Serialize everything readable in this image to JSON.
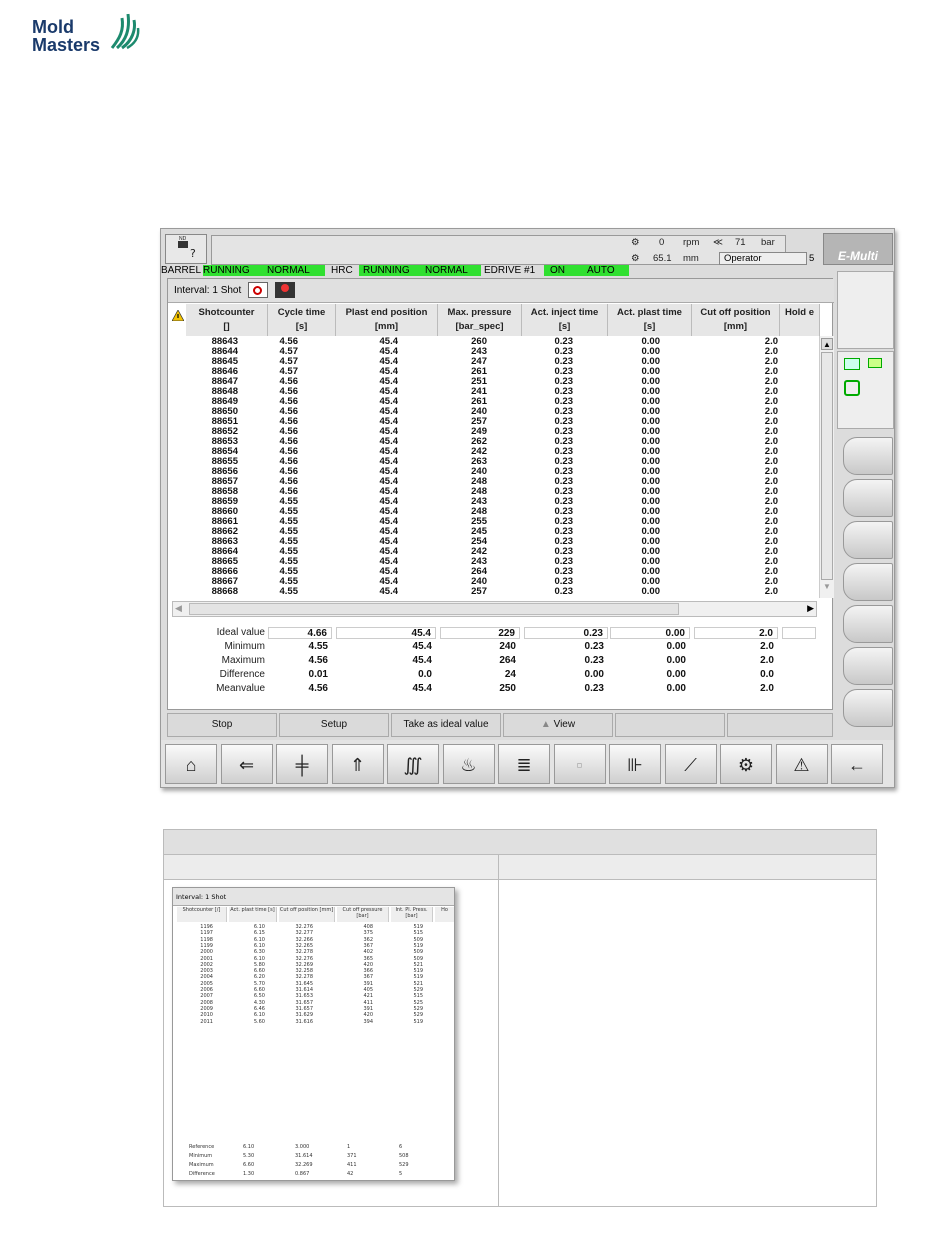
{
  "logo": {
    "line1": "Mold",
    "line2": "Masters",
    "reg": "®"
  },
  "header": {
    "top_button_icon": "help-icon",
    "rpm_value": "0",
    "rpm_unit": "rpm",
    "pressure_value": "71",
    "pressure_unit": "bar",
    "position_value": "65.1",
    "position_unit": "mm",
    "user": "Operator",
    "user_level": "5",
    "brand": "E-Multi"
  },
  "status": {
    "barrel": "BARREL",
    "barrel_state": "RUNNING",
    "barrel_mode": "NORMAL",
    "hrc": "HRC",
    "hrc_state": "RUNNING",
    "hrc_mode": "NORMAL",
    "edrive": "EDRIVE #1",
    "edrive_state": "ON",
    "edrive_mode": "AUTO"
  },
  "interval": {
    "label": "Interval:",
    "value": "1 Shot"
  },
  "columns": [
    {
      "name": "Shotcounter",
      "unit": "[]"
    },
    {
      "name": "Cycle time",
      "unit": "[s]"
    },
    {
      "name": "Plast end position",
      "unit": "[mm]"
    },
    {
      "name": "Max. pressure",
      "unit": "[bar_spec]"
    },
    {
      "name": "Act. inject time",
      "unit": "[s]"
    },
    {
      "name": "Act. plast time",
      "unit": "[s]"
    },
    {
      "name": "Cut off position",
      "unit": "[mm]"
    },
    {
      "name": "Hold e",
      "unit": ""
    }
  ],
  "rows": [
    [
      "88643",
      "4.56",
      "45.4",
      "260",
      "0.23",
      "0.00",
      "2.0"
    ],
    [
      "88644",
      "4.57",
      "45.4",
      "243",
      "0.23",
      "0.00",
      "2.0"
    ],
    [
      "88645",
      "4.57",
      "45.4",
      "247",
      "0.23",
      "0.00",
      "2.0"
    ],
    [
      "88646",
      "4.57",
      "45.4",
      "261",
      "0.23",
      "0.00",
      "2.0"
    ],
    [
      "88647",
      "4.56",
      "45.4",
      "251",
      "0.23",
      "0.00",
      "2.0"
    ],
    [
      "88648",
      "4.56",
      "45.4",
      "241",
      "0.23",
      "0.00",
      "2.0"
    ],
    [
      "88649",
      "4.56",
      "45.4",
      "261",
      "0.23",
      "0.00",
      "2.0"
    ],
    [
      "88650",
      "4.56",
      "45.4",
      "240",
      "0.23",
      "0.00",
      "2.0"
    ],
    [
      "88651",
      "4.56",
      "45.4",
      "257",
      "0.23",
      "0.00",
      "2.0"
    ],
    [
      "88652",
      "4.56",
      "45.4",
      "249",
      "0.23",
      "0.00",
      "2.0"
    ],
    [
      "88653",
      "4.56",
      "45.4",
      "262",
      "0.23",
      "0.00",
      "2.0"
    ],
    [
      "88654",
      "4.56",
      "45.4",
      "242",
      "0.23",
      "0.00",
      "2.0"
    ],
    [
      "88655",
      "4.56",
      "45.4",
      "263",
      "0.23",
      "0.00",
      "2.0"
    ],
    [
      "88656",
      "4.56",
      "45.4",
      "240",
      "0.23",
      "0.00",
      "2.0"
    ],
    [
      "88657",
      "4.56",
      "45.4",
      "248",
      "0.23",
      "0.00",
      "2.0"
    ],
    [
      "88658",
      "4.56",
      "45.4",
      "248",
      "0.23",
      "0.00",
      "2.0"
    ],
    [
      "88659",
      "4.55",
      "45.4",
      "243",
      "0.23",
      "0.00",
      "2.0"
    ],
    [
      "88660",
      "4.55",
      "45.4",
      "248",
      "0.23",
      "0.00",
      "2.0"
    ],
    [
      "88661",
      "4.55",
      "45.4",
      "255",
      "0.23",
      "0.00",
      "2.0"
    ],
    [
      "88662",
      "4.55",
      "45.4",
      "245",
      "0.23",
      "0.00",
      "2.0"
    ],
    [
      "88663",
      "4.55",
      "45.4",
      "254",
      "0.23",
      "0.00",
      "2.0"
    ],
    [
      "88664",
      "4.55",
      "45.4",
      "242",
      "0.23",
      "0.00",
      "2.0"
    ],
    [
      "88665",
      "4.55",
      "45.4",
      "243",
      "0.23",
      "0.00",
      "2.0"
    ],
    [
      "88666",
      "4.55",
      "45.4",
      "264",
      "0.23",
      "0.00",
      "2.0"
    ],
    [
      "88667",
      "4.55",
      "45.4",
      "240",
      "0.23",
      "0.00",
      "2.0"
    ],
    [
      "88668",
      "4.55",
      "45.4",
      "257",
      "0.23",
      "0.00",
      "2.0"
    ]
  ],
  "summary": [
    {
      "label": "Ideal value",
      "values": [
        "4.66",
        "45.4",
        "229",
        "0.23",
        "0.00",
        "2.0"
      ]
    },
    {
      "label": "Minimum",
      "values": [
        "4.55",
        "45.4",
        "240",
        "0.23",
        "0.00",
        "2.0"
      ]
    },
    {
      "label": "Maximum",
      "values": [
        "4.56",
        "45.4",
        "264",
        "0.23",
        "0.00",
        "2.0"
      ]
    },
    {
      "label": "Difference",
      "values": [
        "0.01",
        "0.0",
        "24",
        "0.00",
        "0.00",
        "0.0"
      ]
    },
    {
      "label": "Meanvalue",
      "values": [
        "4.56",
        "45.4",
        "250",
        "0.23",
        "0.00",
        "2.0"
      ]
    }
  ],
  "buttons": {
    "stop": "Stop",
    "setup": "Setup",
    "ideal": "Take as ideal value",
    "view": "View"
  },
  "nav_icons": [
    "home-icon",
    "inject-icon",
    "clamp-icon",
    "eject-icon",
    "temperature-icon",
    "hot-runner-icon",
    "list-icon",
    "disabled-icon",
    "core-icon",
    "graph-icon",
    "settings-icon",
    "alarm-icon",
    "back-icon"
  ],
  "thumbnail": {
    "interval": "Interval: 1 Shot",
    "columns": [
      "Shotcounter [/]",
      "Act. plast time [s]",
      "Cut off position [mm]",
      "Cut off pressure [bar]",
      "Int. Pl. Press. [bar]",
      "Ho"
    ],
    "rows": [
      [
        "1196",
        "6.10",
        "32.276",
        "408",
        "519"
      ],
      [
        "1197",
        "6.15",
        "32.277",
        "375",
        "515"
      ],
      [
        "1198",
        "6.10",
        "32.266",
        "362",
        "509"
      ],
      [
        "1199",
        "6.10",
        "32.265",
        "367",
        "519"
      ],
      [
        "2000",
        "6.30",
        "32.278",
        "402",
        "509"
      ],
      [
        "2001",
        "6.10",
        "32.276",
        "365",
        "509"
      ],
      [
        "2002",
        "5.80",
        "32.269",
        "420",
        "521"
      ],
      [
        "2003",
        "6.60",
        "32.258",
        "366",
        "519"
      ],
      [
        "2004",
        "6.20",
        "32.278",
        "367",
        "519"
      ],
      [
        "2005",
        "5.70",
        "31.645",
        "391",
        "521"
      ],
      [
        "2006",
        "6.60",
        "31.614",
        "405",
        "529"
      ],
      [
        "2007",
        "6.50",
        "31.653",
        "421",
        "515"
      ],
      [
        "2008",
        "4.30",
        "31.657",
        "411",
        "525"
      ],
      [
        "2009",
        "6.46",
        "31.657",
        "391",
        "529"
      ],
      [
        "2010",
        "6.10",
        "31.629",
        "420",
        "529"
      ],
      [
        "2011",
        "5.60",
        "31.616",
        "394",
        "519"
      ]
    ],
    "summary": [
      {
        "label": "Reference",
        "values": [
          "6.10",
          "3.000",
          "1",
          "6"
        ]
      },
      {
        "label": "Minimum",
        "values": [
          "5.30",
          "31.614",
          "371",
          "508"
        ]
      },
      {
        "label": "Maximum",
        "values": [
          "6.60",
          "32.269",
          "411",
          "529"
        ]
      },
      {
        "label": "Difference",
        "values": [
          "1.30",
          "0.867",
          "42",
          "5"
        ]
      }
    ]
  }
}
